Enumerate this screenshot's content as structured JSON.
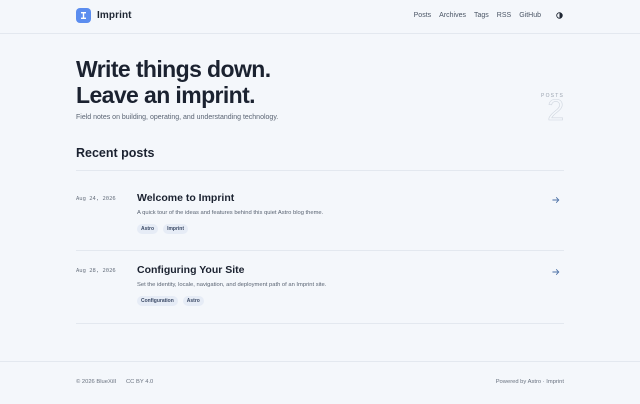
{
  "site": {
    "name": "Imprint"
  },
  "nav": {
    "items": [
      "Posts",
      "Archives",
      "Tags",
      "RSS",
      "GitHub"
    ],
    "theme_icon": "half-moon-icon"
  },
  "hero": {
    "title_line1": "Write things down.",
    "title_line2": "Leave an imprint.",
    "subtitle": "Field notes on building, operating, and understanding technology.",
    "posts_label": "POSTS",
    "posts_count": "2"
  },
  "recent": {
    "heading": "Recent posts",
    "posts": [
      {
        "date": "Aug 24, 2026",
        "title": "Welcome to Imprint",
        "description": "A quick tour of the ideas and features behind this quiet Astro blog theme.",
        "tags": [
          "Astro",
          "Imprint"
        ]
      },
      {
        "date": "Aug 28, 2026",
        "title": "Configuring Your Site",
        "description": "Set the identity, locale, navigation, and deployment path of an Imprint site.",
        "tags": [
          "Configuration",
          "Astro"
        ]
      }
    ]
  },
  "footer": {
    "copyright": "© 2026 BlueXiII",
    "license": "CC BY 4.0",
    "powered": "Powered by Astro · Imprint"
  },
  "colors": {
    "accent": "#5b8def",
    "background": "#f4f7fb",
    "text": "#1f2733"
  }
}
